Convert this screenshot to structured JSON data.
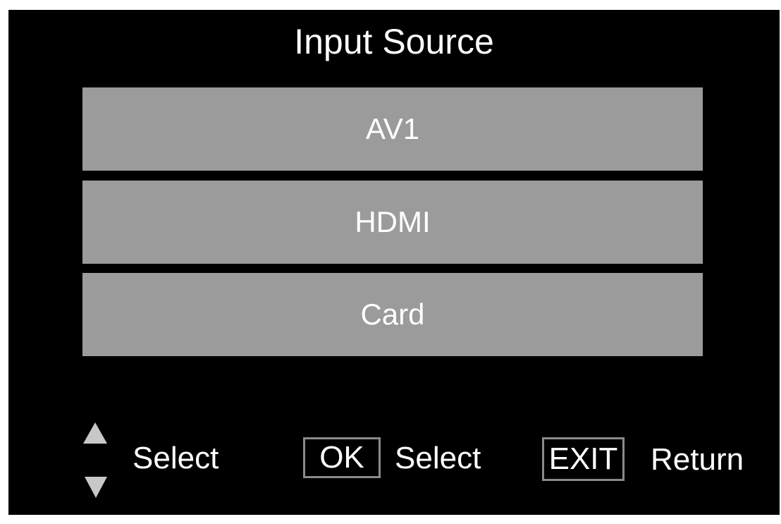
{
  "title": "Input Source",
  "sources": [
    {
      "label": "AV1"
    },
    {
      "label": "HDMI"
    },
    {
      "label": "Card"
    }
  ],
  "hints": {
    "nav_label": "Select",
    "ok_key": "OK",
    "ok_label": "Select",
    "exit_key": "EXIT",
    "exit_label": "Return"
  },
  "colors": {
    "background": "#000000",
    "item_background": "#9b9b9b",
    "text": "#ffffff",
    "key_border": "#8a8a8a",
    "arrow": "#c8c8c8"
  },
  "icons": {
    "up": "triangle-up-icon",
    "down": "triangle-down-icon"
  }
}
